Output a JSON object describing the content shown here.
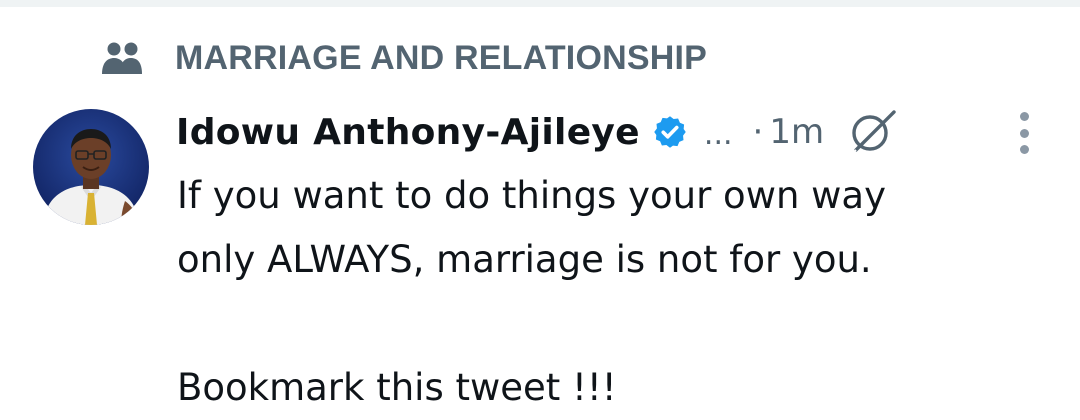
{
  "community": {
    "icon": "community-icon",
    "label": "MARRIAGE AND RELATIONSHIP"
  },
  "tweet": {
    "author": {
      "name": "Idowu Anthony-Ajileye",
      "verified_icon": "verified-badge-icon",
      "handle_truncated": "...",
      "avatar": "author-avatar"
    },
    "separator": "·",
    "time": "1m",
    "grok_icon": "grok-icon",
    "more_icon": "more-options-icon",
    "text_lines": [
      "If you want to do things your own way",
      "only ALWAYS, marriage is not for you.",
      "Bookmark this tweet !!!"
    ]
  },
  "colors": {
    "secondary_text": "#536471",
    "primary_text": "#0f1419",
    "verified_blue": "#1d9bf0",
    "divider": "#eff3f4"
  }
}
